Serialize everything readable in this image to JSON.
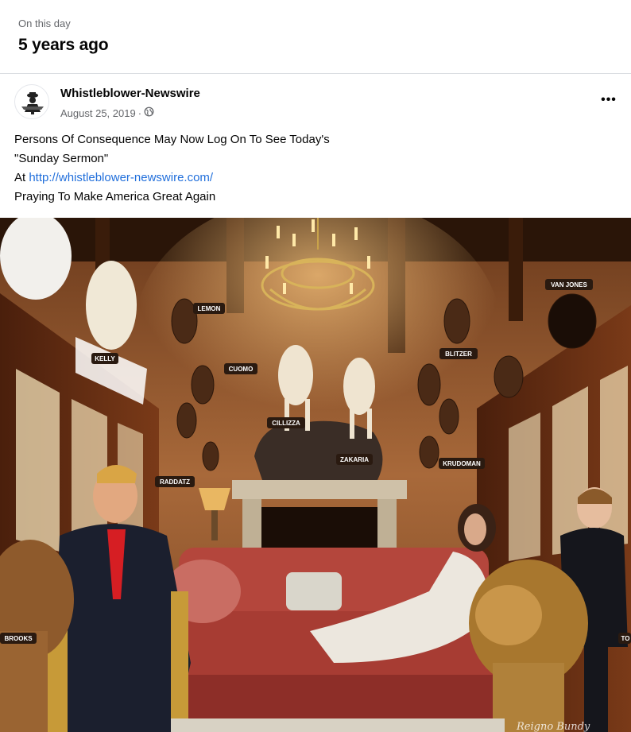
{
  "memory": {
    "label": "On this day",
    "title": "5 years ago"
  },
  "post": {
    "author": "Whistleblower-Newswire",
    "date": "August 25, 2019",
    "separator": "·",
    "more_label": "•••",
    "text": {
      "line1": "Persons Of Consequence May Now Log On To See Today's",
      "line2": "\"Sunday Sermon\"",
      "line3_prefix": "At ",
      "link": "http://whistleblower-newswire.com/",
      "line4": "Praying To Make America Great Again"
    }
  },
  "image": {
    "labels": {
      "van_jones": "VAN JONES",
      "lemon": "LEMON",
      "kelly": "KELLY",
      "blitzer": "BLITZER",
      "cuomo": "CUOMO",
      "cillizza": "CILLIZZA",
      "zakaria": "ZAKARIA",
      "kurdoman": "KRUDOMAN",
      "raddatz": "RADDATZ",
      "brooks": "BROOKS",
      "edge": "TO",
      "signature": "Reigno Bundy"
    }
  },
  "colors": {
    "accent_link": "#216fdb",
    "secondary_text": "#65676b"
  },
  "icons": {
    "privacy": "globe-icon",
    "more": "more-options-icon"
  }
}
